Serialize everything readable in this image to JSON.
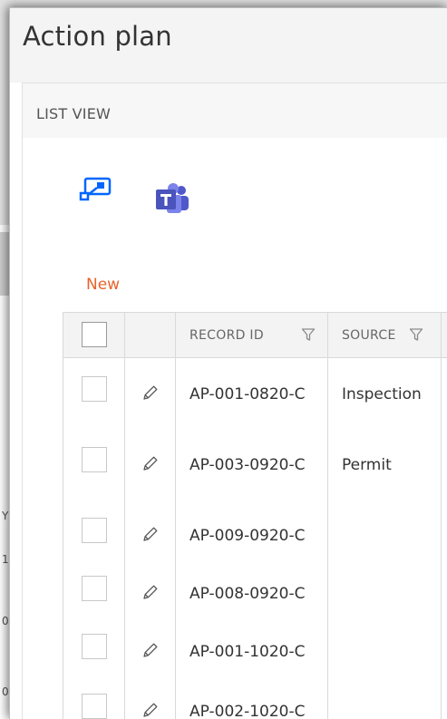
{
  "background": {
    "fragments": [
      "Y",
      "1-",
      "0-",
      "0-"
    ]
  },
  "dialog": {
    "title": "Action plan"
  },
  "list_view": {
    "label": "LIST VIEW"
  },
  "toolbar": {
    "icons": [
      "power-automate-icon",
      "teams-icon"
    ],
    "new_label": "New"
  },
  "grid": {
    "columns": [
      {
        "label": "RECORD ID",
        "filter": true
      },
      {
        "label": "SOURCE",
        "filter": true
      }
    ],
    "rows": [
      {
        "record_id": "AP-001-0820-C",
        "source": "Inspection"
      },
      {
        "record_id": "AP-003-0920-C",
        "source": "Permit"
      },
      {
        "record_id": "AP-009-0920-C",
        "source": ""
      },
      {
        "record_id": "AP-008-0920-C",
        "source": ""
      },
      {
        "record_id": "AP-001-1020-C",
        "source": ""
      },
      {
        "record_id": "AP-002-1020-C",
        "source": ""
      }
    ]
  },
  "colors": {
    "accent": "#e8632c",
    "teams": "#5059c9",
    "flow": "#0066ff"
  }
}
